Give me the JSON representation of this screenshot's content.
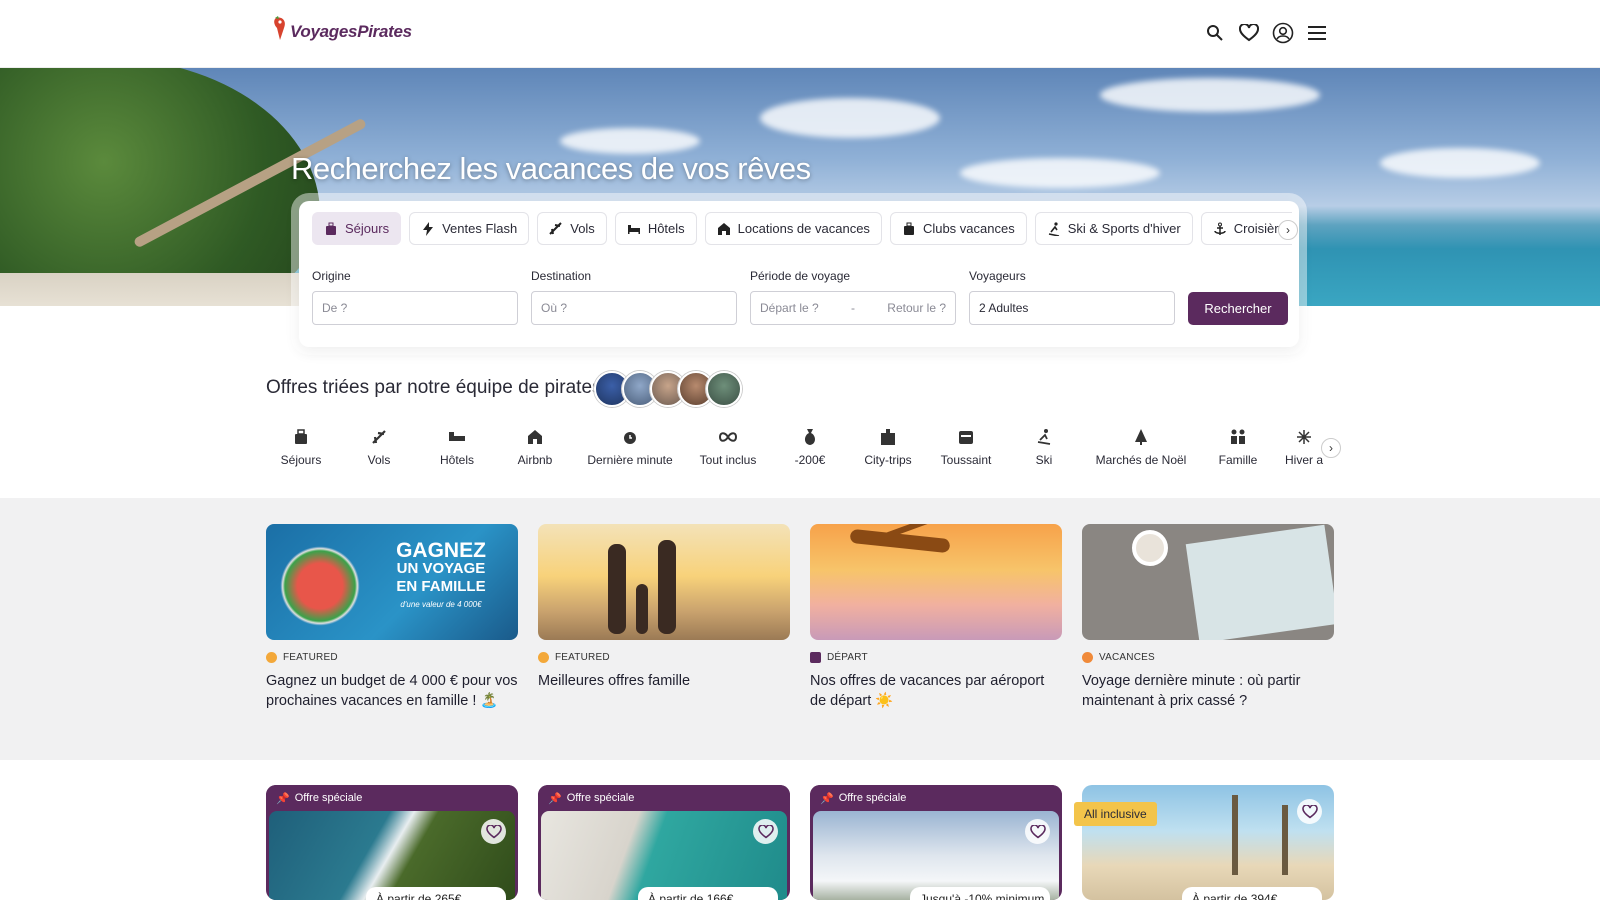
{
  "header": {
    "logo_text": "VoyagesPirates",
    "icons": [
      "search-icon",
      "heart-icon",
      "user-icon",
      "menu-icon"
    ]
  },
  "hero": {
    "title": "Recherchez les vacances de vos rêves"
  },
  "search": {
    "tabs": [
      {
        "label": "Séjours",
        "icon": "luggage-icon",
        "active": true
      },
      {
        "label": "Ventes Flash",
        "icon": "flash-icon"
      },
      {
        "label": "Vols",
        "icon": "plane-icon"
      },
      {
        "label": "Hôtels",
        "icon": "bed-icon"
      },
      {
        "label": "Locations de vacances",
        "icon": "house-icon"
      },
      {
        "label": "Clubs vacances",
        "icon": "bag-icon"
      },
      {
        "label": "Ski & Sports d'hiver",
        "icon": "ski-icon"
      },
      {
        "label": "Croisière",
        "icon": "anchor-icon"
      }
    ],
    "fields": {
      "origin": {
        "label": "Origine",
        "placeholder": "De ?"
      },
      "destination": {
        "label": "Destination",
        "placeholder": "Où ?"
      },
      "period": {
        "label": "Période de voyage",
        "depart": "Départ le ?",
        "sep": "-",
        "retour": "Retour le ?"
      },
      "travellers": {
        "label": "Voyageurs",
        "value": "2 Adultes"
      }
    },
    "button": "Rechercher"
  },
  "picks": {
    "title": "Offres triées par notre équipe de pirates"
  },
  "categories": [
    {
      "label": "Séjours",
      "icon": "luggage-icon"
    },
    {
      "label": "Vols",
      "icon": "plane-icon"
    },
    {
      "label": "Hôtels",
      "icon": "bed-icon"
    },
    {
      "label": "Airbnb",
      "icon": "house-icon"
    },
    {
      "label": "Dernière minute",
      "icon": "alarm-icon"
    },
    {
      "label": "Tout inclus",
      "icon": "infinity-icon"
    },
    {
      "label": "-200€",
      "icon": "moneybag-icon"
    },
    {
      "label": "City-trips",
      "icon": "city-icon"
    },
    {
      "label": "Toussaint",
      "icon": "calendar-icon"
    },
    {
      "label": "Ski",
      "icon": "ski-icon"
    },
    {
      "label": "Marchés de Noël",
      "icon": "tree-icon"
    },
    {
      "label": "Famille",
      "icon": "family-icon"
    },
    {
      "label": "Hiver a",
      "icon": "snow-icon"
    }
  ],
  "articles": [
    {
      "tag": "FEATURED",
      "title": "Gagnez un budget de 4 000 € pour vos prochaines vacances en famille ! 🏝️",
      "promo": {
        "l1": "GAGNEZ",
        "l2": "UN VOYAGE",
        "l3": "EN FAMILLE",
        "l4": "d'une valeur de 4 000€"
      }
    },
    {
      "tag": "FEATURED",
      "title": "Meilleures offres famille"
    },
    {
      "tag": "DÉPART",
      "title": "Nos offres de vacances par aéroport de départ ☀️"
    },
    {
      "tag": "VACANCES",
      "title": "Voyage dernière minute : où partir maintenant à prix cassé ?"
    }
  ],
  "offers": [
    {
      "band": "Offre spéciale",
      "price": "À partir de 265€"
    },
    {
      "band": "Offre spéciale",
      "price": "À partir de 166€"
    },
    {
      "band": "Offre spéciale",
      "price": "Jusqu'à -10% minimum"
    },
    {
      "badge": "All inclusive",
      "price": "À partir de 394€"
    }
  ],
  "colors": {
    "brand": "#5b2a5e",
    "accent": "#f3c44a"
  }
}
